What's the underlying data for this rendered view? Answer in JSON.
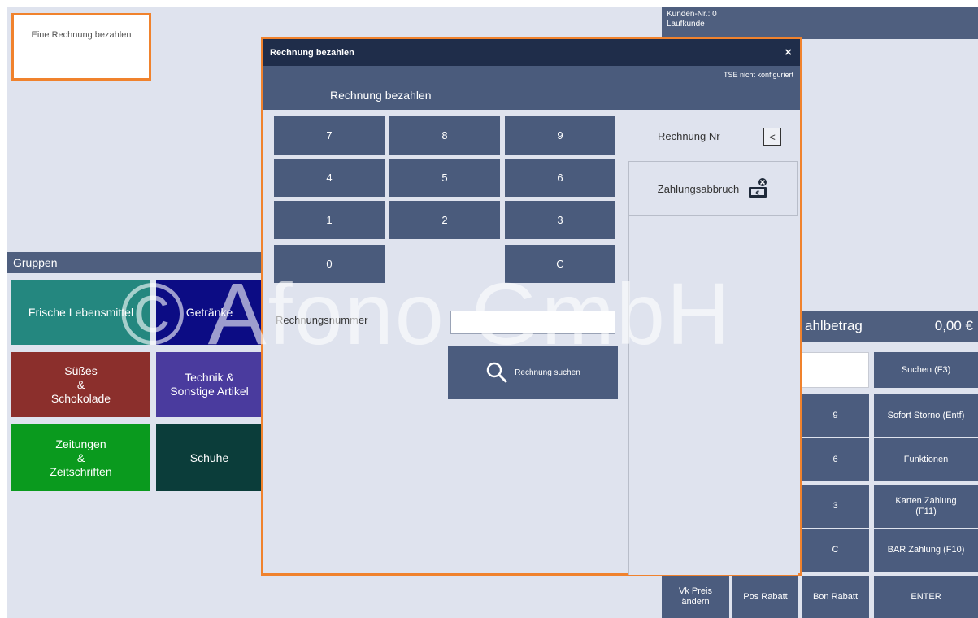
{
  "background": {
    "pay_tile_label": "Eine Rechnung bezahlen",
    "groups_header": "Gruppen",
    "groups": [
      {
        "label": "Frische Lebensmittel",
        "color": "#24877f"
      },
      {
        "label": "Getränke",
        "color": "#0c0c84"
      },
      {
        "label": "Süßes\n&\nSchokolade",
        "color": "#8b2f2c"
      },
      {
        "label": "Technik &\nSonstige Artikel",
        "color": "#4a3b9e"
      },
      {
        "label": "Zeitungen\n&\nZeitschriften",
        "color": "#0a9a1e"
      },
      {
        "label": "Schuhe",
        "color": "#0b3d3a"
      }
    ],
    "customer_no": "Kunden-Nr.: 0",
    "customer_name": "Laufkunde",
    "total_label": "ahlbetrag",
    "total_value": "0,00 €",
    "right_buttons": {
      "search": "Suchen (F3)",
      "key_9": "9",
      "instant_cancel": "Sofort Storno (Entf)",
      "key_6": "6",
      "functions": "Funktionen",
      "key_3": "3",
      "card_payment": "Karten Zahlung\n(F11)",
      "key_c": "C",
      "cash_payment": "BAR Zahlung (F10)",
      "vk_price": "Vk Preis\nändern",
      "pos_discount": "Pos Rabatt",
      "bon_discount": "Bon Rabatt",
      "enter": "ENTER"
    }
  },
  "dialog": {
    "title": "Rechnung bezahlen",
    "close": "×",
    "tse_status": "TSE nicht konfiguriert",
    "heading": "Rechnung bezahlen",
    "keypad": [
      "7",
      "8",
      "9",
      "4",
      "5",
      "6",
      "1",
      "2",
      "3",
      "0",
      "C"
    ],
    "invoice_no_label": "Rechnung Nr",
    "invoice_no_button": "<",
    "abort_label": "Zahlungsabbruch",
    "invoice_number_label": "Rechnungsnummer",
    "invoice_number_value": "",
    "search_button": "Rechnung suchen"
  },
  "watermark": "© Afono GmbH",
  "colors": {
    "accent_orange": "#f0822d",
    "navy_button": "#4a5b7c",
    "title_bar": "#1f2d4a",
    "background": "#dfe3ee"
  }
}
